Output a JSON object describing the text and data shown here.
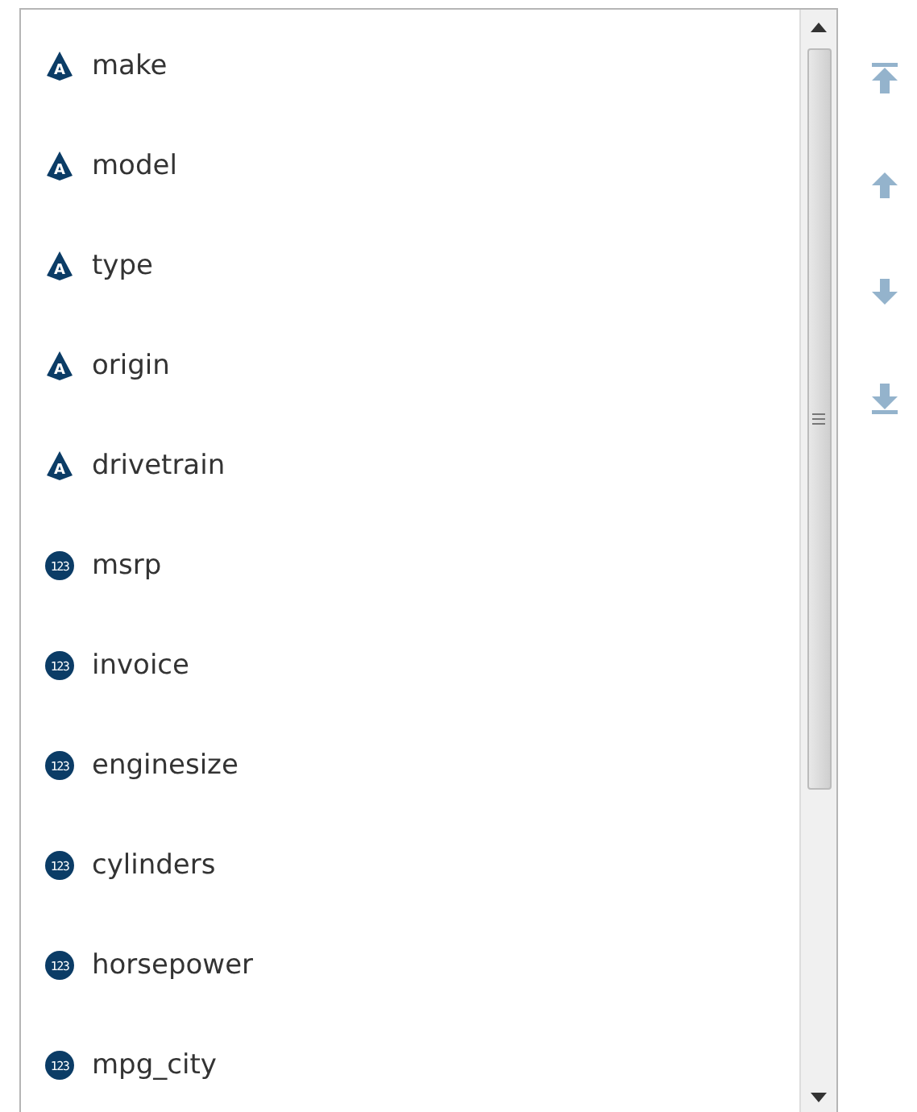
{
  "variables": [
    {
      "name": "make",
      "kind": "character",
      "badge": "A"
    },
    {
      "name": "model",
      "kind": "character",
      "badge": "A"
    },
    {
      "name": "type",
      "kind": "character",
      "badge": "A"
    },
    {
      "name": "origin",
      "kind": "character",
      "badge": "A"
    },
    {
      "name": "drivetrain",
      "kind": "character",
      "badge": "A"
    },
    {
      "name": "msrp",
      "kind": "numeric",
      "badge": "123"
    },
    {
      "name": "invoice",
      "kind": "numeric",
      "badge": "123"
    },
    {
      "name": "enginesize",
      "kind": "numeric",
      "badge": "123"
    },
    {
      "name": "cylinders",
      "kind": "numeric",
      "badge": "123"
    },
    {
      "name": "horsepower",
      "kind": "numeric",
      "badge": "123"
    },
    {
      "name": "mpg_city",
      "kind": "numeric",
      "badge": "123"
    }
  ],
  "move_buttons": [
    {
      "kind": "top",
      "disabled": true
    },
    {
      "kind": "up",
      "disabled": true
    },
    {
      "kind": "down",
      "disabled": true
    },
    {
      "kind": "bottom",
      "disabled": true
    }
  ]
}
